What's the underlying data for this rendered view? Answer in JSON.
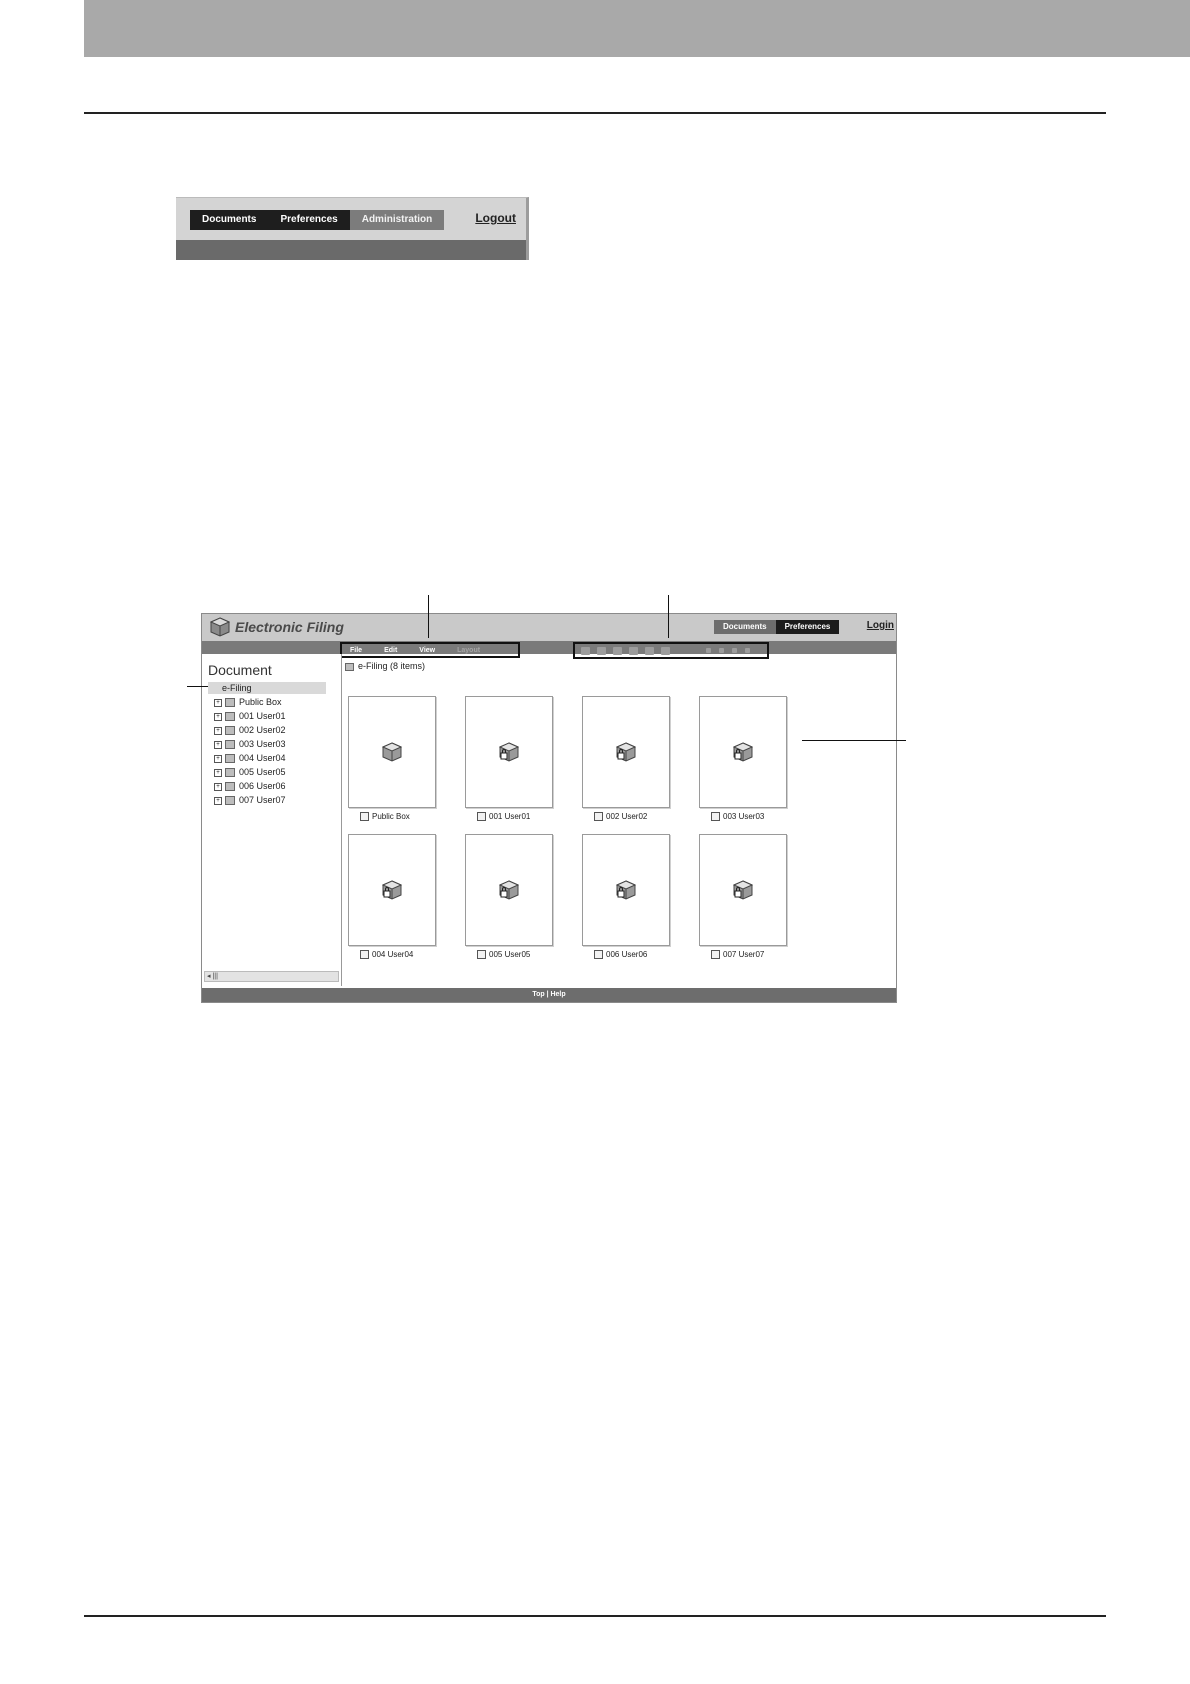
{
  "tab_screenshot": {
    "tabs": [
      {
        "label": "Documents",
        "active": false
      },
      {
        "label": "Preferences",
        "active": false
      },
      {
        "label": "Administration",
        "active": true
      }
    ],
    "logout_label": "Logout"
  },
  "efiling": {
    "app_title": "Electronic Filing",
    "nav_tabs": [
      "Documents",
      "Preferences"
    ],
    "login_label": "Login",
    "menu": {
      "file": "File",
      "edit": "Edit",
      "view": "View",
      "layout": "Layout"
    },
    "left_pane": {
      "title": "Document",
      "root": "e-Filing",
      "tree_items": [
        "Public Box",
        "001 User01",
        "002 User02",
        "003 User03",
        "004 User04",
        "005 User05",
        "006 User06",
        "007 User07"
      ]
    },
    "path_label": "e-Filing  (8 items)",
    "boxes": [
      {
        "label": "Public Box",
        "locked": false
      },
      {
        "label": "001 User01",
        "locked": true
      },
      {
        "label": "002 User02",
        "locked": true
      },
      {
        "label": "003 User03",
        "locked": true
      },
      {
        "label": "004 User04",
        "locked": true
      },
      {
        "label": "005 User05",
        "locked": true
      },
      {
        "label": "006 User06",
        "locked": true
      },
      {
        "label": "007 User07",
        "locked": true
      }
    ],
    "footer": "Top | Help"
  },
  "colors": {
    "header_band": "#a9a9a9",
    "tab_dark": "#1e1e1e",
    "tab_active": "#7c7c7c",
    "toolbar": "#7a7a7a"
  }
}
